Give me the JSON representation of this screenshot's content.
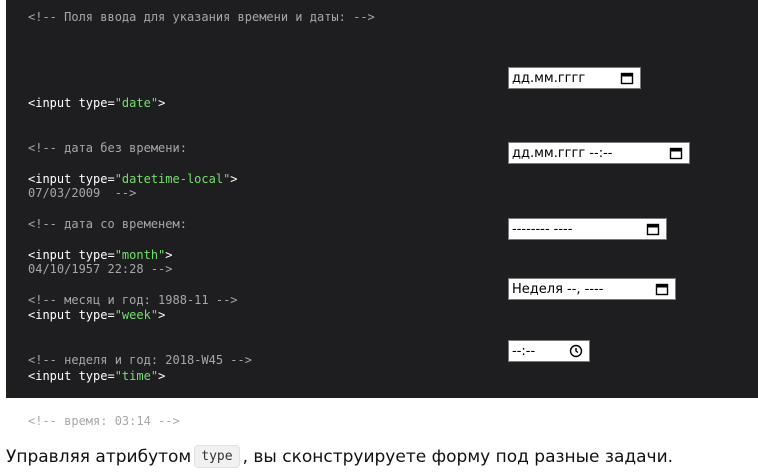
{
  "header_comment": "<!-- Поля ввода для указания времени и даты: -->",
  "items": [
    {
      "tag_open": "<input type=",
      "type_value": "\"date\"",
      "tag_close": ">",
      "comment_line1": "<!-- дата без времени:",
      "comment_line2": "07/03/2009  -->",
      "field_text": "дд.мм.гггг",
      "icon": "calendar-icon"
    },
    {
      "tag_open": "<input type=",
      "type_value": "\"datetime-local\"",
      "tag_close": ">",
      "comment_line1": "<!-- дата со временем:",
      "comment_line2": "04/10/1957 22:28 -->",
      "field_text": "дд.мм.гггг --:--",
      "icon": "calendar-icon"
    },
    {
      "tag_open": "<input type=",
      "type_value": "\"month\"",
      "tag_close": ">",
      "comment_line1": "<!-- месяц и год: 1988-11 -->",
      "field_text": "-------- ----",
      "icon": "calendar-icon"
    },
    {
      "tag_open": "<input type=",
      "type_value": "\"week\"",
      "tag_close": ">",
      "comment_line1": "<!-- неделя и год: 2018-W45 -->",
      "field_text": "Неделя --, ----",
      "icon": "calendar-icon"
    },
    {
      "tag_open": "<input type=",
      "type_value": "\"time\"",
      "tag_close": ">",
      "comment_line1": "<!-- время: 03:14 -->",
      "field_text": "--:--",
      "icon": "clock-icon"
    }
  ],
  "footer": {
    "before": "Управляя атрибутом",
    "code": "type",
    "after": ", вы сконструируете форму под разные задачи."
  }
}
